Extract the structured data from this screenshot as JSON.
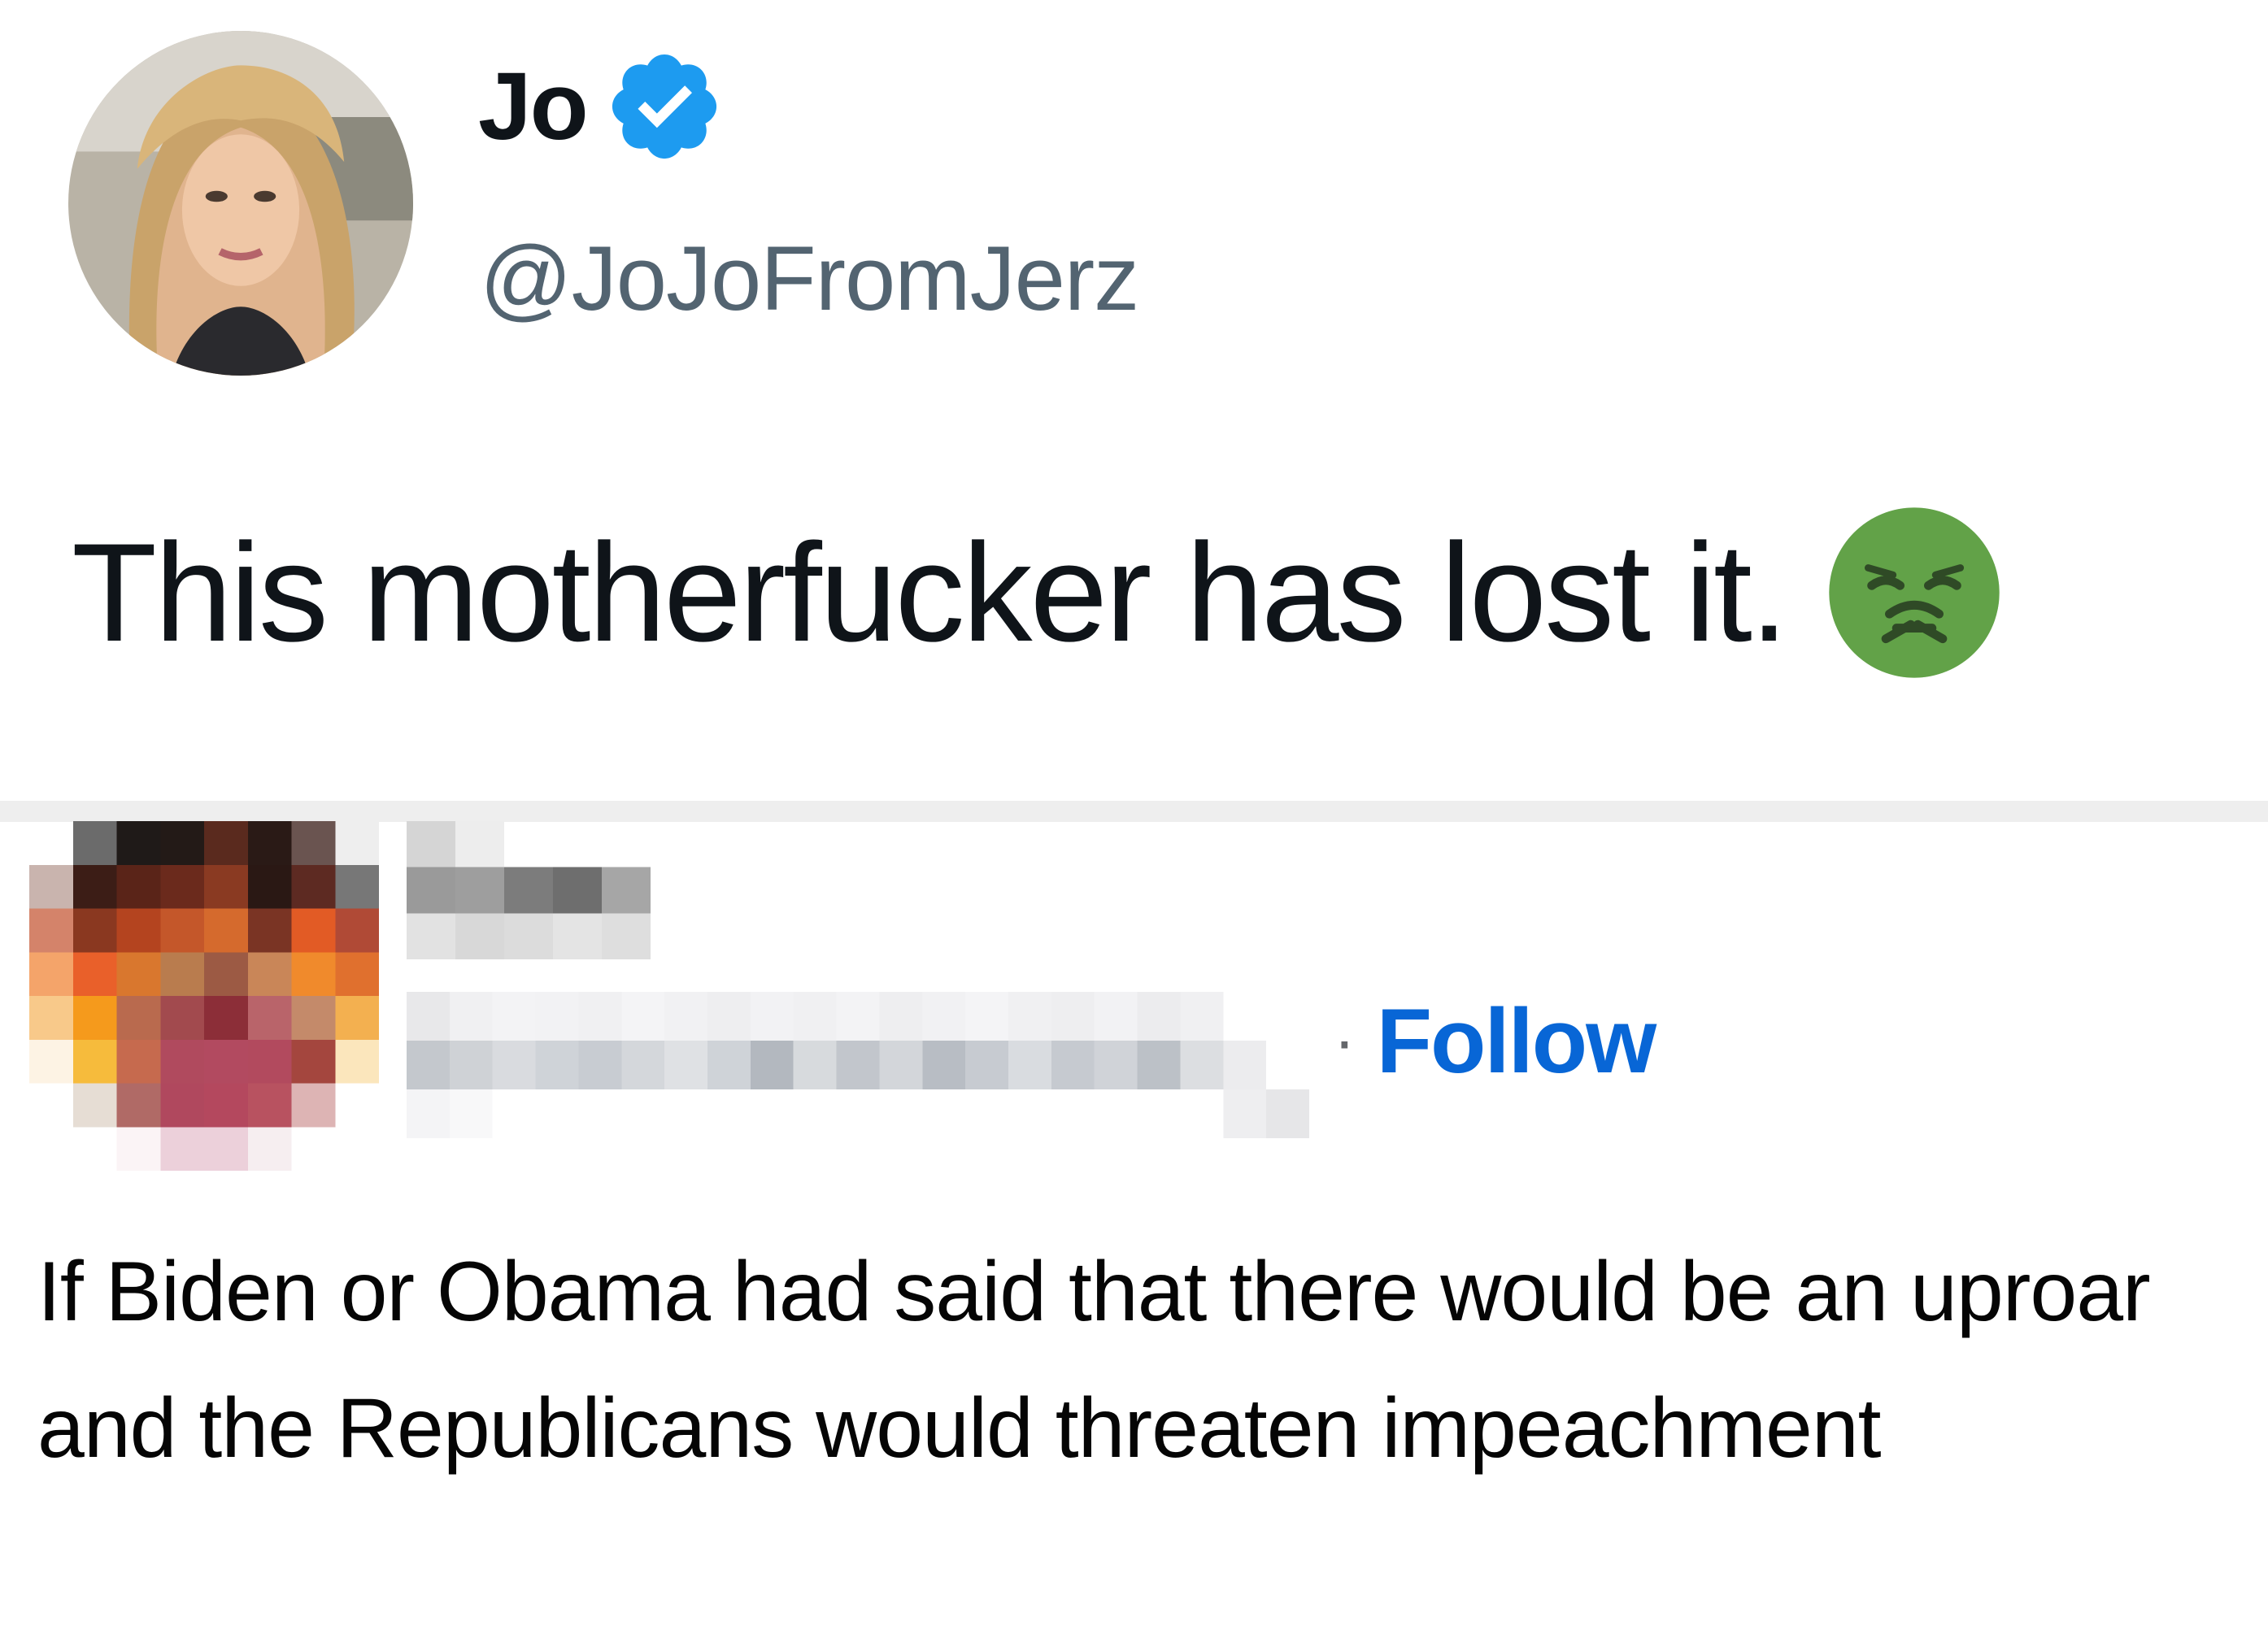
{
  "tweet": {
    "author_name": "Jo",
    "author_handle": "@JoJoFromJerz",
    "verified": true,
    "text": "This motherfucker has lost it.",
    "emoji": "nauseated-face",
    "verified_color": "#1d9bf0"
  },
  "comment": {
    "follow_separator": "·",
    "follow_label": "Follow",
    "follow_color": "#0866d6",
    "text": "If Biden or Obama had said that there would be an uproar and the Republicans would threaten impeachment",
    "commenter_identity": "pixelated"
  }
}
